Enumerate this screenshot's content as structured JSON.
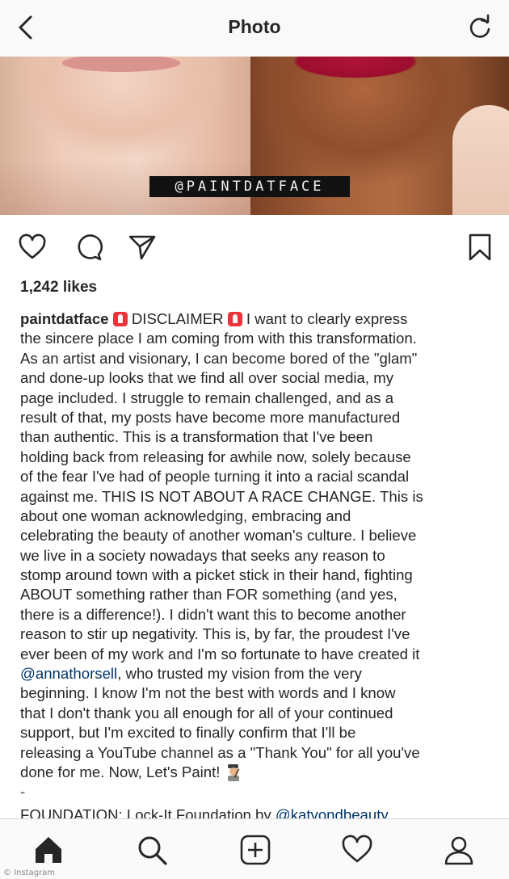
{
  "header": {
    "title": "Photo",
    "back_icon": "chevron-left-icon",
    "refresh_icon": "refresh-icon"
  },
  "photo": {
    "watermark": "@PAINTDATFACE"
  },
  "actions": {
    "icons": [
      "heart-icon",
      "comment-icon",
      "share-icon",
      "bookmark-icon"
    ]
  },
  "likes": "1,242 likes",
  "caption": {
    "username": "paintdatface",
    "l1_disclaimer": "DISCLAIMER",
    "l1_text": "I want to clearly express",
    "lines": [
      "the sincere place I am coming from with this transformation.",
      "As an artist and visionary, I can become bored of the \"glam\"",
      "and done-up looks that we find all over social media, my",
      "page included. I struggle to remain challenged, and as a",
      "result of that, my posts have become more manufactured",
      "than authentic. This is a transformation that I've been",
      "holding back from releasing for awhile now, solely because",
      "of the fear I've had of people turning it into a racial scandal",
      "against me. THIS IS NOT ABOUT A RACE CHANGE. This is",
      "about one woman acknowledging, embracing and",
      "celebrating the beauty of another woman's culture. I believe",
      "we live in a society nowadays that seeks any reason to",
      "stomp around town with a picket stick in their hand, fighting",
      "ABOUT something rather than FOR something (and yes,",
      "there is a difference!). I didn't want this to become another",
      "reason to stir up negativity. This is, by far, the proudest I've",
      "ever been of my work and I'm so fortunate to have created it"
    ],
    "mention_line_handle": "@annathorsell",
    "mention_line_rest": ", who trusted my vision from the very",
    "lines2": [
      "beginning. I know I'm not the best with words and I know",
      "that I don't thank you all enough for all of your continued",
      "support, but I'm excited to finally confirm that I'll be",
      "releasing a YouTube channel as a \"Thank You\" for all you've"
    ],
    "final_line": "done for me. Now, Let's Paint!",
    "dash": "-",
    "foundation_label": "FOUNDATION: Lock-It Foundation by",
    "foundation_handle": "@katvondbeauty"
  },
  "bottom_nav": {
    "icons": [
      "home-icon",
      "search-icon",
      "add-post-icon",
      "activity-heart-icon",
      "profile-icon"
    ]
  },
  "credit": "© Instagram"
}
